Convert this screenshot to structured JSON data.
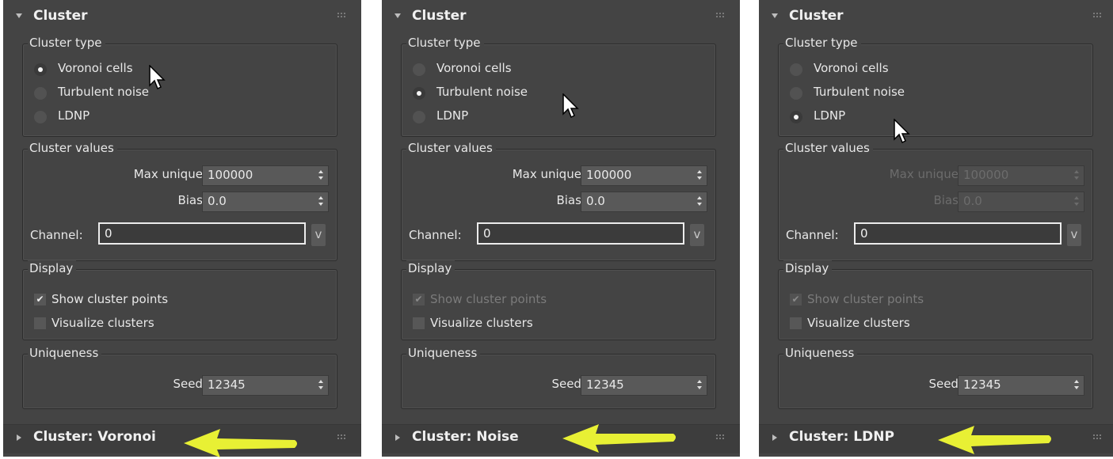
{
  "panels": [
    {
      "header": "Cluster",
      "cluster_type": {
        "title": "Cluster type",
        "options": [
          "Voronoi cells",
          "Turbulent noise",
          "LDNP"
        ],
        "selected": "Voronoi cells"
      },
      "cluster_values": {
        "title": "Cluster values",
        "enabled": true,
        "max_unique_label": "Max unique:",
        "max_unique_value": "100000",
        "bias_label": "Bias:",
        "bias_value": "0.0",
        "channel_label": "Channel:",
        "channel_value": "0",
        "v_button": "v"
      },
      "display": {
        "title": "Display",
        "show_points_label": "Show cluster points",
        "show_points_checked": true,
        "show_points_enabled": true,
        "visualize_label": "Visualize clusters",
        "visualize_checked": false
      },
      "uniqueness": {
        "title": "Uniqueness",
        "seed_label": "Seed:",
        "seed_value": "12345"
      },
      "bottom_rollout": "Cluster: Voronoi"
    },
    {
      "header": "Cluster",
      "cluster_type": {
        "title": "Cluster type",
        "options": [
          "Voronoi cells",
          "Turbulent noise",
          "LDNP"
        ],
        "selected": "Turbulent noise"
      },
      "cluster_values": {
        "title": "Cluster values",
        "enabled": true,
        "max_unique_label": "Max unique:",
        "max_unique_value": "100000",
        "bias_label": "Bias:",
        "bias_value": "0.0",
        "channel_label": "Channel:",
        "channel_value": "0",
        "v_button": "v"
      },
      "display": {
        "title": "Display",
        "show_points_label": "Show cluster points",
        "show_points_checked": true,
        "show_points_enabled": false,
        "visualize_label": "Visualize clusters",
        "visualize_checked": false
      },
      "uniqueness": {
        "title": "Uniqueness",
        "seed_label": "Seed:",
        "seed_value": "12345"
      },
      "bottom_rollout": "Cluster: Noise"
    },
    {
      "header": "Cluster",
      "cluster_type": {
        "title": "Cluster type",
        "options": [
          "Voronoi cells",
          "Turbulent noise",
          "LDNP"
        ],
        "selected": "LDNP"
      },
      "cluster_values": {
        "title": "Cluster values",
        "enabled": false,
        "max_unique_label": "Max unique:",
        "max_unique_value": "100000",
        "bias_label": "Bias:",
        "bias_value": "0.0",
        "channel_label": "Channel:",
        "channel_value": "0",
        "v_button": "v"
      },
      "display": {
        "title": "Display",
        "show_points_label": "Show cluster points",
        "show_points_checked": true,
        "show_points_enabled": false,
        "visualize_label": "Visualize clusters",
        "visualize_checked": false
      },
      "uniqueness": {
        "title": "Uniqueness",
        "seed_label": "Seed:",
        "seed_value": "12345"
      },
      "bottom_rollout": "Cluster: LDNP"
    }
  ],
  "colors": {
    "panel_bg": "#444444",
    "text": "#e8e8e8",
    "highlight_arrow": "#e8f034",
    "disabled_text": "#6c6c6c"
  }
}
